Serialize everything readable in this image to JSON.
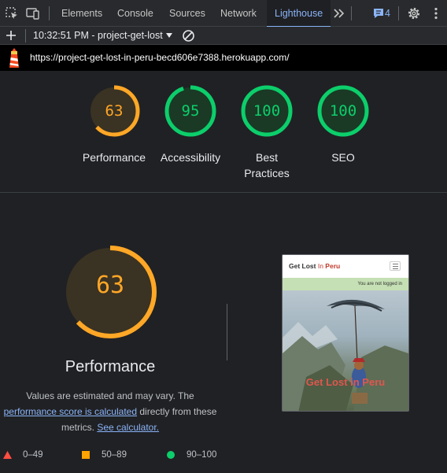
{
  "devtools": {
    "tabs": [
      "Elements",
      "Console",
      "Sources",
      "Network",
      "Lighthouse"
    ],
    "active_tab": "Lighthouse",
    "issues_count": "4",
    "accent_color": "#8ab4f8"
  },
  "lighthouse_toolbar": {
    "report_label": "10:32:51 PM - project-get-lost"
  },
  "url": "https://project-get-lost-in-peru-becd606e7388.herokuapp.com/",
  "categories": [
    {
      "label": "Performance",
      "score": 63,
      "score_text": "63",
      "color": "#ffa726"
    },
    {
      "label": "Accessibility",
      "score": 95,
      "score_text": "95",
      "color": "#0cce6b"
    },
    {
      "label": "Best Practices",
      "score": 100,
      "score_text": "100",
      "color": "#0cce6b"
    },
    {
      "label": "SEO",
      "score": 100,
      "score_text": "100",
      "color": "#0cce6b"
    }
  ],
  "performance_detail": {
    "score": 63,
    "score_text": "63",
    "title": "Performance",
    "description_prefix": "Values are estimated and may vary. The",
    "score_link": "performance score is calculated",
    "description_middle": "directly from these metrics.",
    "calculator_link": "See calculator."
  },
  "legend": [
    {
      "range": "0–49",
      "color": "#ff4e42",
      "shape": "triangle"
    },
    {
      "range": "50–89",
      "color": "#ffa400",
      "shape": "square"
    },
    {
      "range": "90–100",
      "color": "#0cce6b",
      "shape": "circle"
    }
  ],
  "screenshot": {
    "brand_get": "Get Lost ",
    "brand_in": "In ",
    "brand_peru": "Peru",
    "status_text": "You are not logged in",
    "hero_title": "Get Lost in Peru"
  }
}
